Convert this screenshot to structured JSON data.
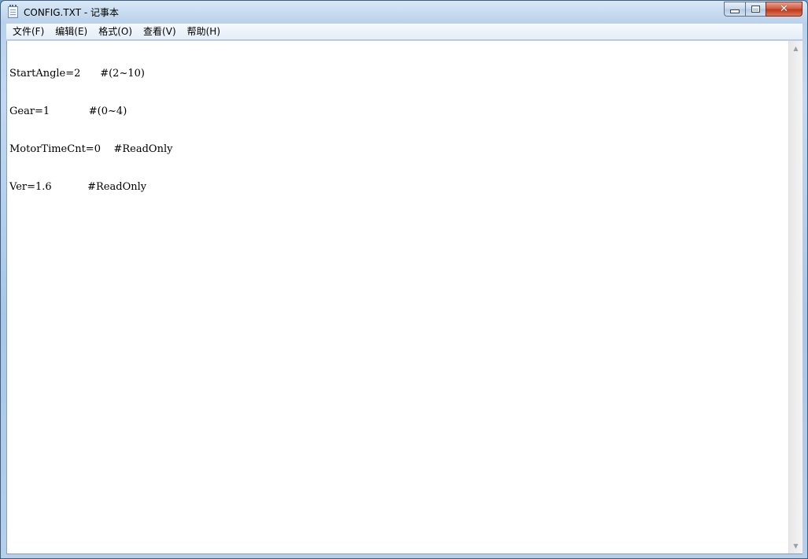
{
  "window": {
    "title": "CONFIG.TXT - 记事本",
    "app_icon": "notepad-icon",
    "caption_buttons": {
      "minimize_icon": "minimize-icon",
      "maximize_icon": "maximize-icon",
      "close_icon": "close-icon",
      "close_glyph": "✕"
    },
    "close_color": "#c7432a"
  },
  "menubar": {
    "items": [
      {
        "label": "文件(F)"
      },
      {
        "label": "编辑(E)"
      },
      {
        "label": "格式(O)"
      },
      {
        "label": "查看(V)"
      },
      {
        "label": "帮助(H)"
      }
    ]
  },
  "document": {
    "lines": [
      "StartAngle=2      #(2~10)",
      "Gear=1            #(0~4)",
      "MotorTimeCnt=0    #ReadOnly",
      "Ver=1.6           #ReadOnly"
    ]
  },
  "scrollbar": {
    "up_glyph": "▲",
    "down_glyph": "▼"
  }
}
